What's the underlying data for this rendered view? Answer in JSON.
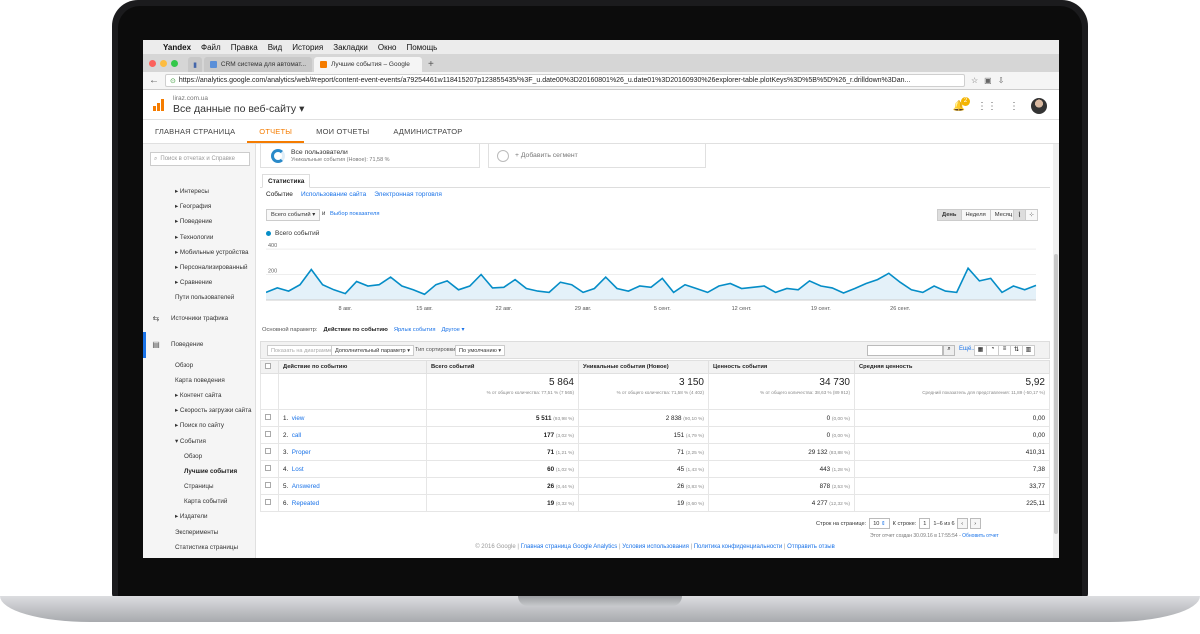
{
  "menubar": {
    "items": [
      "Yandex",
      "Файл",
      "Правка",
      "Вид",
      "История",
      "Закладки",
      "Окно",
      "Помощь"
    ]
  },
  "browser": {
    "tabs": [
      {
        "label": "CRM система для автомат..."
      },
      {
        "label": "Лучшие события – Google"
      }
    ],
    "url": "https://analytics.google.com/analytics/web/#report/content-event-events/a79254461w118415207p123855435/%3F_u.date00%3D20160801%26_u.date01%3D20160930%26explorer-table.plotKeys%3D%5B%5D%26_r.drilldown%3Dan..."
  },
  "ga": {
    "domain": "liraz.com.ua",
    "view": "Все данные по веб-сайту",
    "notif_count": "2",
    "nav_tabs": [
      "ГЛАВНАЯ СТРАНИЦА",
      "ОТЧЕТЫ",
      "МОИ ОТЧЕТЫ",
      "АДМИНИСТРАТОР"
    ]
  },
  "sidebar": {
    "search_placeholder": "Поиск в отчетах и Справке",
    "items": [
      {
        "label": "▸ Интересы",
        "level": "l1"
      },
      {
        "label": "▸ География",
        "level": "l1"
      },
      {
        "label": "▸ Поведение",
        "level": "l1"
      },
      {
        "label": "▸ Технологии",
        "level": "l1"
      },
      {
        "label": "▸ Мобильные устройства",
        "level": "l1"
      },
      {
        "label": "▸ Персонализированный",
        "level": "l1"
      },
      {
        "label": "▸ Сравнение",
        "level": "l1"
      },
      {
        "label": "Пути пользователей",
        "level": "l1"
      },
      {
        "label": "Источники трафика",
        "level": "sect",
        "icon": "⇆"
      },
      {
        "label": "Поведение",
        "level": "sect active",
        "icon": "▤"
      },
      {
        "label": "Обзор",
        "level": "l1"
      },
      {
        "label": "Карта поведения",
        "level": "l1"
      },
      {
        "label": "▸ Контент сайта",
        "level": "l1"
      },
      {
        "label": "▸ Скорость загрузки сайта",
        "level": "l1"
      },
      {
        "label": "▸ Поиск по сайту",
        "level": "l1"
      },
      {
        "label": "▾ События",
        "level": "l1"
      },
      {
        "label": "Обзор",
        "level": "l2"
      },
      {
        "label": "Лучшие события",
        "level": "l2 sel"
      },
      {
        "label": "Страницы",
        "level": "l2"
      },
      {
        "label": "Карта событий",
        "level": "l2"
      },
      {
        "label": "▸ Издатели",
        "level": "l1"
      },
      {
        "label": "Эксперименты",
        "level": "l1"
      },
      {
        "label": "Статистика страницы",
        "level": "l1"
      }
    ]
  },
  "segments": {
    "all_users": "Все пользователи",
    "all_users_sub": "Уникальные события (Новое): 71,58 %",
    "add_segment": "+ Добавить сегмент"
  },
  "report": {
    "stat_tab": "Статистика",
    "subtabs": [
      "Событие",
      "Использование сайта",
      "Электронная торговля"
    ],
    "metric_select": "Всего событий",
    "and": "и",
    "pick_metric": "Выбор показателя",
    "periods": [
      "День",
      "Неделя",
      "Месяц"
    ],
    "legend_label": "Всего событий",
    "primary_label": "Основной параметр:",
    "primary_value": "Действие по событию",
    "primary_links": [
      "Ярлык события",
      "Другое ▾"
    ],
    "toolbar": {
      "plot_rows": "Показать на диаграмме",
      "secondary": "Дополнительный параметр ▾",
      "sort_label": "Тип сортировки:",
      "sort_value": "По умолчанию ▾",
      "more": "Ещё..."
    }
  },
  "chart_data": {
    "type": "area",
    "series": [
      {
        "name": "Всего событий",
        "values": [
          60,
          95,
          70,
          120,
          240,
          120,
          80,
          50,
          145,
          110,
          120,
          180,
          110,
          80,
          45,
          120,
          150,
          80,
          110,
          200,
          95,
          100,
          160,
          90,
          70,
          60,
          140,
          120,
          60,
          90,
          180,
          90,
          70,
          110,
          100,
          170,
          60,
          120,
          90,
          60,
          110,
          130,
          90,
          100,
          110,
          60,
          90,
          80,
          150,
          110,
          95,
          55,
          90,
          130,
          160,
          210,
          140,
          80,
          60,
          110,
          70,
          60,
          250,
          150,
          170,
          60,
          110,
          80,
          115
        ]
      }
    ],
    "x_ticks": [
      "8 авг.",
      "15 авг.",
      "22 авг.",
      "29 авг.",
      "5 сент.",
      "12 сент.",
      "19 сент.",
      "26 сент."
    ],
    "y_ticks": [
      "400",
      "200"
    ],
    "ylim": [
      0,
      440
    ],
    "color": "#058dc7",
    "fill": "#e4f1f9"
  },
  "table": {
    "headers": [
      "Действие по событию",
      "Всего событий",
      "Уникальные события (Новое)",
      "Ценность события",
      "Средняя ценность"
    ],
    "totals": [
      {
        "value": "5 864",
        "sub": "% от общего количества: 77,51 % (7 565)"
      },
      {
        "value": "3 150",
        "sub": "% от общего количества: 71,58 % (4 402)"
      },
      {
        "value": "34 730",
        "sub": "% от общего количества: 38,63 % (89 912)"
      },
      {
        "value": "5,92",
        "sub": "Средний показатель для представления: 11,89 (-50,17 %)"
      }
    ],
    "rows": [
      {
        "n": "1.",
        "action": "view",
        "total": "5 511",
        "total_pct": "(93,98 %)",
        "uniq": "2 838",
        "uniq_pct": "(90,10 %)",
        "value": "0",
        "value_pct": "(0,00 %)",
        "avg": "0,00"
      },
      {
        "n": "2.",
        "action": "call",
        "total": "177",
        "total_pct": "(3,02 %)",
        "uniq": "151",
        "uniq_pct": "(4,79 %)",
        "value": "0",
        "value_pct": "(0,00 %)",
        "avg": "0,00"
      },
      {
        "n": "3.",
        "action": "Proper",
        "total": "71",
        "total_pct": "(1,21 %)",
        "uniq": "71",
        "uniq_pct": "(2,25 %)",
        "value": "29 132",
        "value_pct": "(83,88 %)",
        "avg": "410,31"
      },
      {
        "n": "4.",
        "action": "Lost",
        "total": "60",
        "total_pct": "(1,02 %)",
        "uniq": "45",
        "uniq_pct": "(1,43 %)",
        "value": "443",
        "value_pct": "(1,28 %)",
        "avg": "7,38"
      },
      {
        "n": "5.",
        "action": "Answered",
        "total": "26",
        "total_pct": "(0,44 %)",
        "uniq": "26",
        "uniq_pct": "(0,83 %)",
        "value": "878",
        "value_pct": "(2,53 %)",
        "avg": "33,77"
      },
      {
        "n": "6.",
        "action": "Repeated",
        "total": "19",
        "total_pct": "(0,32 %)",
        "uniq": "19",
        "uniq_pct": "(0,60 %)",
        "value": "4 277",
        "value_pct": "(12,32 %)",
        "avg": "225,11"
      }
    ],
    "pager": {
      "rows_label": "Строк на странице:",
      "rows_value": "10",
      "goto_label": "К строке:",
      "goto_value": "1",
      "range": "1–6 из 6"
    },
    "report_note": "Этот отчет создан 30.09.16 в 17:55:54 -",
    "refresh_link": "Обновить отчет"
  },
  "footer": {
    "copyright": "© 2016 Google |",
    "links": [
      "Главная страница Google Analytics",
      "Условия использования",
      "Политика конфиденциальности",
      "Отправить отзыв"
    ]
  }
}
